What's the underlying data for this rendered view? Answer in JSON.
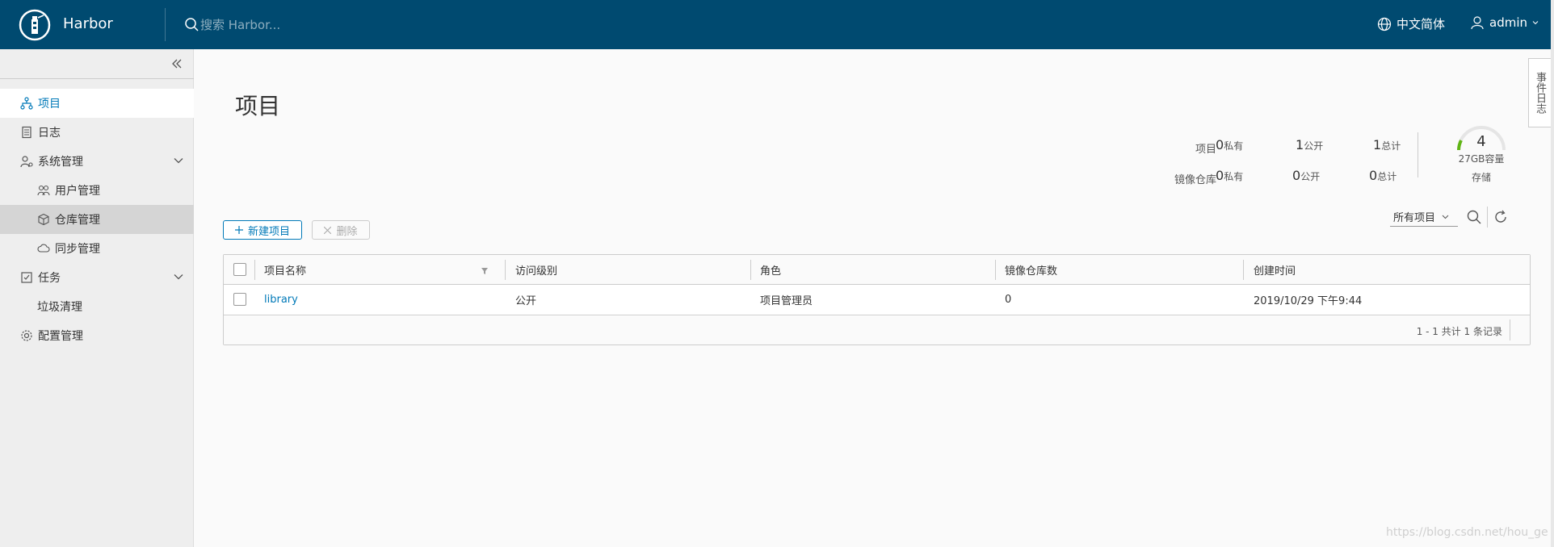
{
  "header": {
    "brand": "Harbor",
    "search_placeholder": "搜索 Harbor...",
    "language": "中文简体",
    "user": "admin"
  },
  "sidebar": {
    "items": [
      {
        "label": "项目",
        "icon": "project-icon",
        "state": "active"
      },
      {
        "label": "日志",
        "icon": "log-icon"
      },
      {
        "label": "系统管理",
        "icon": "user-settings-icon",
        "expandable": true
      },
      {
        "label": "用户管理",
        "icon": "users-icon",
        "sub": true
      },
      {
        "label": "仓库管理",
        "icon": "cube-icon",
        "sub": true,
        "state": "selected"
      },
      {
        "label": "同步管理",
        "icon": "cloud-sync-icon",
        "sub": true
      },
      {
        "label": "任务",
        "icon": "task-icon",
        "expandable": true
      },
      {
        "label": "垃圾清理",
        "sub": true
      },
      {
        "label": "配置管理",
        "icon": "gear-icon"
      }
    ]
  },
  "page": {
    "title": "项目"
  },
  "stats": {
    "project_label": "项目",
    "repo_label": "镜像仓库",
    "project": {
      "private": "0",
      "public": "1",
      "total": "1"
    },
    "repo": {
      "private": "0",
      "public": "0",
      "total": "0"
    },
    "private_unit": "私有",
    "public_unit": "公开",
    "total_unit": "总计",
    "storage_count": "4",
    "storage_capacity": "27GB容量",
    "storage_label": "存储"
  },
  "toolbar": {
    "new_project": "新建项目",
    "delete": "删除",
    "filter": "所有项目"
  },
  "table": {
    "columns": [
      "项目名称",
      "访问级别",
      "角色",
      "镜像仓库数",
      "创建时间"
    ],
    "rows": [
      {
        "name": "library",
        "access": "公开",
        "role": "项目管理员",
        "repo_count": "0",
        "created": "2019/10/29 下午9:44"
      }
    ],
    "footer": "1 - 1 共计 1 条记录"
  },
  "event_log_tab": "事件日志",
  "watermark": "https://blog.csdn.net/hou_ge",
  "colors": {
    "header_bg": "#004a70",
    "accent": "#0079b8",
    "sidebar_bg": "#eeeeee"
  }
}
